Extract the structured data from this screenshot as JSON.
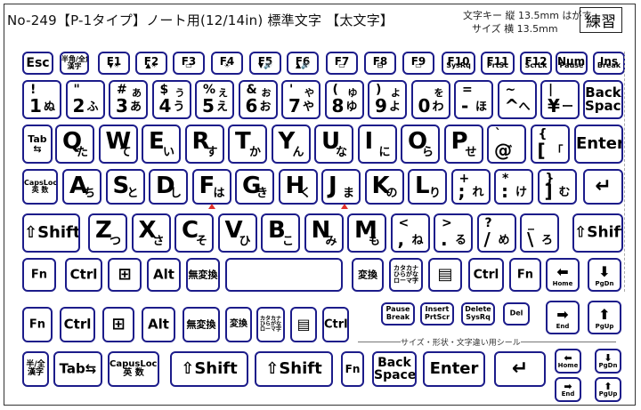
{
  "header": {
    "title": "No-249【P-1タイプ】ノート用(12/14in) 標準文字 【太文字】",
    "spec_line1_a": "文字キー 縦 13.5mm",
    "spec_line1_b": "はがす",
    "spec_line2": "サイズ 横 13.5mm",
    "badge": "練習"
  },
  "row_fn": [
    {
      "label": "Esc",
      "sub": ""
    },
    {
      "label": "半角/全角\n漢字",
      "sub": ""
    },
    {
      "label": "F1",
      "sub": "▼☀"
    },
    {
      "label": "F2",
      "sub": "▲☀"
    },
    {
      "label": "F3",
      "sub": "▭"
    },
    {
      "label": "F4",
      "sub": "☀"
    },
    {
      "label": "F5",
      "sub": "▼🔊"
    },
    {
      "label": "F6",
      "sub": "▲🔊"
    },
    {
      "label": "F7",
      "sub": "▭"
    },
    {
      "label": "F8",
      "sub": "⊟"
    },
    {
      "label": "F9",
      "sub": "▭"
    },
    {
      "label": "F10",
      "sub": "SysRq"
    },
    {
      "label": "F11",
      "sub": "PrtSc"
    },
    {
      "label": "F12",
      "sub": "ScrLk"
    },
    {
      "label": "NumLk",
      "sub": "Pause"
    },
    {
      "label": "Ins",
      "sub": "Break"
    }
  ],
  "row_num": [
    {
      "top": "!",
      "bot": "1",
      "tk": "",
      "bk": "ぬ"
    },
    {
      "top": "\"",
      "bot": "2",
      "tk": "",
      "bk": "ふ"
    },
    {
      "top": "#",
      "bot": "3",
      "tk": "あ",
      "bk": "あ"
    },
    {
      "top": "$",
      "bot": "4",
      "tk": "う",
      "bk": "う"
    },
    {
      "top": "%",
      "bot": "5",
      "tk": "え",
      "bk": "え"
    },
    {
      "top": "&",
      "bot": "6",
      "tk": "お",
      "bk": "お"
    },
    {
      "top": "'",
      "bot": "7",
      "tk": "や",
      "bk": "や"
    },
    {
      "top": "(",
      "bot": "8",
      "tk": "ゆ",
      "bk": "ゆ"
    },
    {
      "top": ")",
      "bot": "9",
      "tk": "よ",
      "bk": "よ"
    },
    {
      "top": "",
      "bot": "0",
      "tk": "を",
      "bk": "わ"
    },
    {
      "top": "=",
      "bot": "-",
      "tk": "",
      "bk": "ほ"
    },
    {
      "top": "~",
      "bot": "^",
      "tk": "",
      "bk": "へ"
    },
    {
      "top": "|",
      "bot": "¥",
      "tk": "",
      "bk": "ー"
    },
    {
      "label": "Back\nSpace"
    }
  ],
  "row_q": [
    {
      "label": "Tab\n⇆"
    },
    {
      "big": "Q",
      "kana": "た"
    },
    {
      "big": "W",
      "kana": "て"
    },
    {
      "big": "E",
      "kana": "い"
    },
    {
      "big": "R",
      "kana": "す"
    },
    {
      "big": "T",
      "kana": "か"
    },
    {
      "big": "Y",
      "kana": "ん"
    },
    {
      "big": "U",
      "kana": "な"
    },
    {
      "big": "I",
      "kana": "に"
    },
    {
      "big": "O",
      "kana": "ら"
    },
    {
      "big": "P",
      "kana": "せ"
    },
    {
      "top": "`",
      "bot": "@",
      "tk": "",
      "bk": "゛"
    },
    {
      "top": "{",
      "bot": "[",
      "tk": "",
      "bk": "「"
    },
    {
      "label": "Enter"
    }
  ],
  "row_a": [
    {
      "label": "CapsLock\n英 数"
    },
    {
      "big": "A",
      "kana": "ち"
    },
    {
      "big": "S",
      "kana": "と"
    },
    {
      "big": "D",
      "kana": "し"
    },
    {
      "big": "F",
      "kana": "は"
    },
    {
      "big": "G",
      "kana": "き"
    },
    {
      "big": "H",
      "kana": "く"
    },
    {
      "big": "J",
      "kana": "ま"
    },
    {
      "big": "K",
      "kana": "の"
    },
    {
      "big": "L",
      "kana": "り"
    },
    {
      "top": "+",
      "bot": ";",
      "tk": "",
      "bk": "れ"
    },
    {
      "top": "*",
      "bot": ":",
      "tk": "",
      "bk": "け"
    },
    {
      "top": "}",
      "bot": "]",
      "tk": "",
      "bk": "む"
    },
    {
      "label": "↵"
    }
  ],
  "row_z": [
    {
      "label": "⇧Shift"
    },
    {
      "big": "Z",
      "kana": "つ"
    },
    {
      "big": "X",
      "kana": "さ"
    },
    {
      "big": "C",
      "kana": "そ"
    },
    {
      "big": "V",
      "kana": "ひ"
    },
    {
      "big": "B",
      "kana": "こ"
    },
    {
      "big": "N",
      "kana": "み"
    },
    {
      "big": "M",
      "kana": "も"
    },
    {
      "top": "<",
      "bot": ",",
      "tk": "",
      "bk": "ね"
    },
    {
      "top": ">",
      "bot": ".",
      "tk": "",
      "bk": "る"
    },
    {
      "top": "?",
      "bot": "/",
      "tk": "",
      "bk": "め"
    },
    {
      "top": "_",
      "bot": "\\",
      "tk": "",
      "bk": "ろ"
    },
    {
      "label": "⇧Shift"
    }
  ],
  "row_bottom": [
    {
      "label": "Fn"
    },
    {
      "label": "Ctrl"
    },
    {
      "label": "⊞"
    },
    {
      "label": "Alt"
    },
    {
      "label": "無変換"
    },
    {
      "label": ""
    },
    {
      "label": "変換"
    },
    {
      "label": "カタカナ\nひらがな\nローマ字"
    },
    {
      "label": "▤"
    },
    {
      "label": "Ctrl"
    },
    {
      "label": "Fn"
    }
  ],
  "arrows": [
    {
      "label": "⬅",
      "sub": "Home"
    },
    {
      "label": "⬇",
      "sub": "PgDn"
    }
  ],
  "row_spare": [
    {
      "label": "Fn"
    },
    {
      "label": "Ctrl"
    },
    {
      "label": "⊞"
    },
    {
      "label": "Alt"
    },
    {
      "label": "無変換"
    },
    {
      "label": "変換"
    },
    {
      "label": "カタカナ\nひらがな\nローマ字"
    },
    {
      "label": "▤"
    },
    {
      "label": "Ctrl"
    }
  ],
  "row_spare_small": [
    {
      "label": "Pause\nBreak"
    },
    {
      "label": "Insert\nPrtScr"
    },
    {
      "label": "Delete\nSysRq"
    },
    {
      "label": "Del"
    }
  ],
  "arrows_spare": [
    {
      "label": "➡",
      "sub": "End"
    },
    {
      "label": "⬆",
      "sub": "PgUp"
    }
  ],
  "guide_label": "サイズ・形状・文字違い用シール",
  "row_last": [
    {
      "label": "半/全\n漢字"
    },
    {
      "label": "Tab⇆"
    },
    {
      "label": "CapusLock\n英 数"
    },
    {
      "label": "⇧Shift"
    },
    {
      "label": "⇧Shift"
    },
    {
      "label": "Fn"
    },
    {
      "label": "Back\nSpace"
    },
    {
      "label": "Enter"
    },
    {
      "label": "↵"
    }
  ],
  "arrows_last": [
    {
      "label": "⬅",
      "sub": "Home"
    },
    {
      "label": "⬇",
      "sub": "PgDn"
    },
    {
      "label": "➡",
      "sub": "End"
    },
    {
      "label": "⬆",
      "sub": "PgUp"
    }
  ]
}
